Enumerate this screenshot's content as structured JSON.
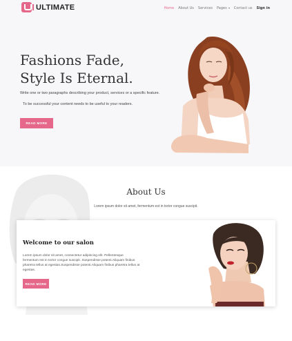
{
  "brand": {
    "logo_text": "ULTIMATE"
  },
  "nav": {
    "items": [
      {
        "label": "Home"
      },
      {
        "label": "About Us"
      },
      {
        "label": "Services"
      },
      {
        "label": "Pages"
      },
      {
        "label": "Contact us"
      }
    ],
    "signin": "Sign in"
  },
  "hero": {
    "title_line1": "Fashions Fade,",
    "title_line2": "Style Is Eternal.",
    "text1": "Write one or two paragraphs describing your product, services or a specific feature.",
    "text2": "To be successful your content needs to be useful to your readers.",
    "button": "READ MORE"
  },
  "about": {
    "title": "About Us",
    "subtitle": "Lorem ipsum dolor sit amet, fermentum est in tortor congue suscipit.",
    "card": {
      "title": "Welcome to our salon",
      "text": "Lorem ipsum dolor sit amet, consectetur adipiscing elit. Pellentesque fermentum est in tortor congue suscipit. Suspendisse potenti.Aliquam finibus pharetra tellus at egestas.Suspendisse potenti.Aliquam finibus pharetra tellus at egestas.",
      "button": "READ MORE"
    }
  },
  "colors": {
    "accent": "#e5688a",
    "hero_bg": "#f7f6f8"
  }
}
